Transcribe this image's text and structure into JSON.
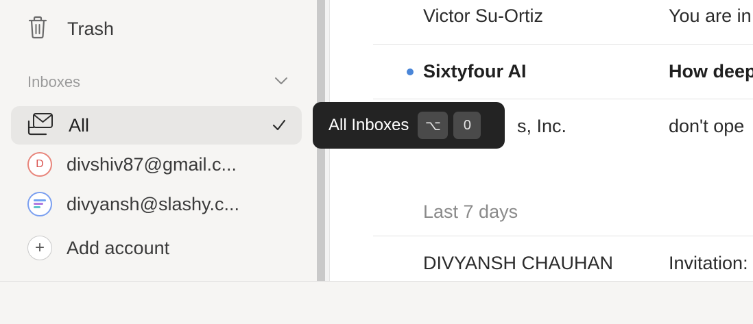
{
  "sidebar": {
    "trash_label": "Trash",
    "inboxes_section_label": "Inboxes",
    "all_label": "All",
    "accounts": [
      {
        "label": "divshiv87@gmail.c...",
        "avatar_letter": "D"
      },
      {
        "label": "divyansh@slashy.c..."
      }
    ],
    "add_account_label": "Add account",
    "add_symbol": "+"
  },
  "messages": [
    {
      "sender": "Victor Su-Ortiz",
      "subject": "You are in",
      "unread": false
    },
    {
      "sender": "Sixtyfour AI",
      "subject": "How deep",
      "unread": true
    },
    {
      "sender": "s, Inc.",
      "subject": "don't ope",
      "unread": false
    }
  ],
  "section_last7": {
    "label": "Last 7 days",
    "messages": [
      {
        "sender": "DIVYANSH CHAUHAN",
        "subject": "Invitation:"
      }
    ]
  },
  "tooltip": {
    "label": "All Inboxes",
    "keys": [
      "⌥",
      "0"
    ]
  },
  "colors": {
    "unread_dot": "#4a86d8",
    "accent_avatar_d": "#e8847a",
    "accent_avatar_s": "#7a9ff0"
  },
  "icons": [
    "trash-icon",
    "chevron-down-icon",
    "inbox-stack-icon",
    "checkmark-icon",
    "plus-icon",
    "slashy-logo-icon"
  ]
}
